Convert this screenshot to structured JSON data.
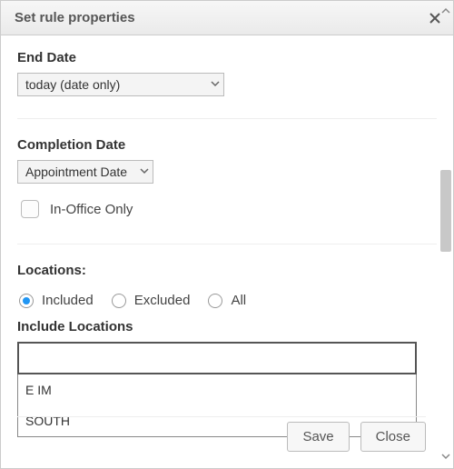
{
  "dialog": {
    "title": "Set rule properties"
  },
  "endDate": {
    "label": "End Date",
    "value": "today (date only)"
  },
  "completionDate": {
    "label": "Completion Date",
    "value": "Appointment Date"
  },
  "inOffice": {
    "label": "In-Office Only",
    "checked": false
  },
  "locations": {
    "label": "Locations:",
    "mode": "included",
    "options": {
      "included": "Included",
      "excluded": "Excluded",
      "all": "All"
    },
    "includeLabel": "Include Locations",
    "inputValue": "",
    "suggestions": [
      "E IM",
      "SOUTH"
    ]
  },
  "buttons": {
    "save": "Save",
    "close": "Close"
  }
}
